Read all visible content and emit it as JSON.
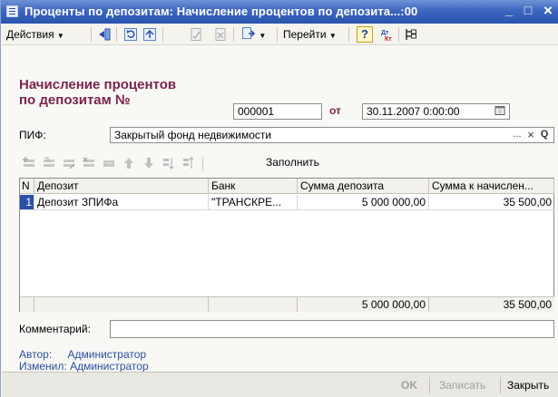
{
  "window": {
    "title": "Проценты по депозитам: Начисление процентов по депозита...:00",
    "minimize": "_",
    "maximize": "□",
    "close": "×"
  },
  "toolbar": {
    "actions_label": "Действия",
    "goto_label": "Перейти",
    "help_label": "?"
  },
  "form": {
    "heading_line1": "Начисление процентов",
    "heading_line2": "по депозитам №",
    "number": "000001",
    "date_label": "от",
    "date_value": "30.11.2007  0:00:00",
    "pif_label": "ПИФ:",
    "pif_value": "Закрытый фонд недвижимости",
    "pif_select": "...",
    "pif_clear": "×",
    "pif_search": "Q",
    "fill_label": "Заполнить",
    "comment_label": "Комментарий:",
    "comment_value": ""
  },
  "table": {
    "columns": [
      "N",
      "Депозит",
      "Банк",
      "Сумма депозита",
      "Сумма к начислен..."
    ],
    "rows": [
      {
        "n": "1",
        "deposit": "Депозит ЗПИФа",
        "bank": "\"ТРАНСКРЕ...",
        "amount": "5 000 000,00",
        "accrual": "35 500,00"
      }
    ],
    "totals": {
      "amount": "5 000 000,00",
      "accrual": "35 500,00"
    }
  },
  "meta": {
    "author_label": "Автор:",
    "author_value": "Администратор",
    "changed_label": "Изменил:",
    "changed_value": "Администратор"
  },
  "buttons": {
    "ok": "OK",
    "save": "Записать",
    "close": "Закрыть"
  },
  "colors": {
    "accent": "#7a2450",
    "title_bar": "#3d66bf",
    "link": "#2a4fa0",
    "selection": "#2c4fa8"
  }
}
